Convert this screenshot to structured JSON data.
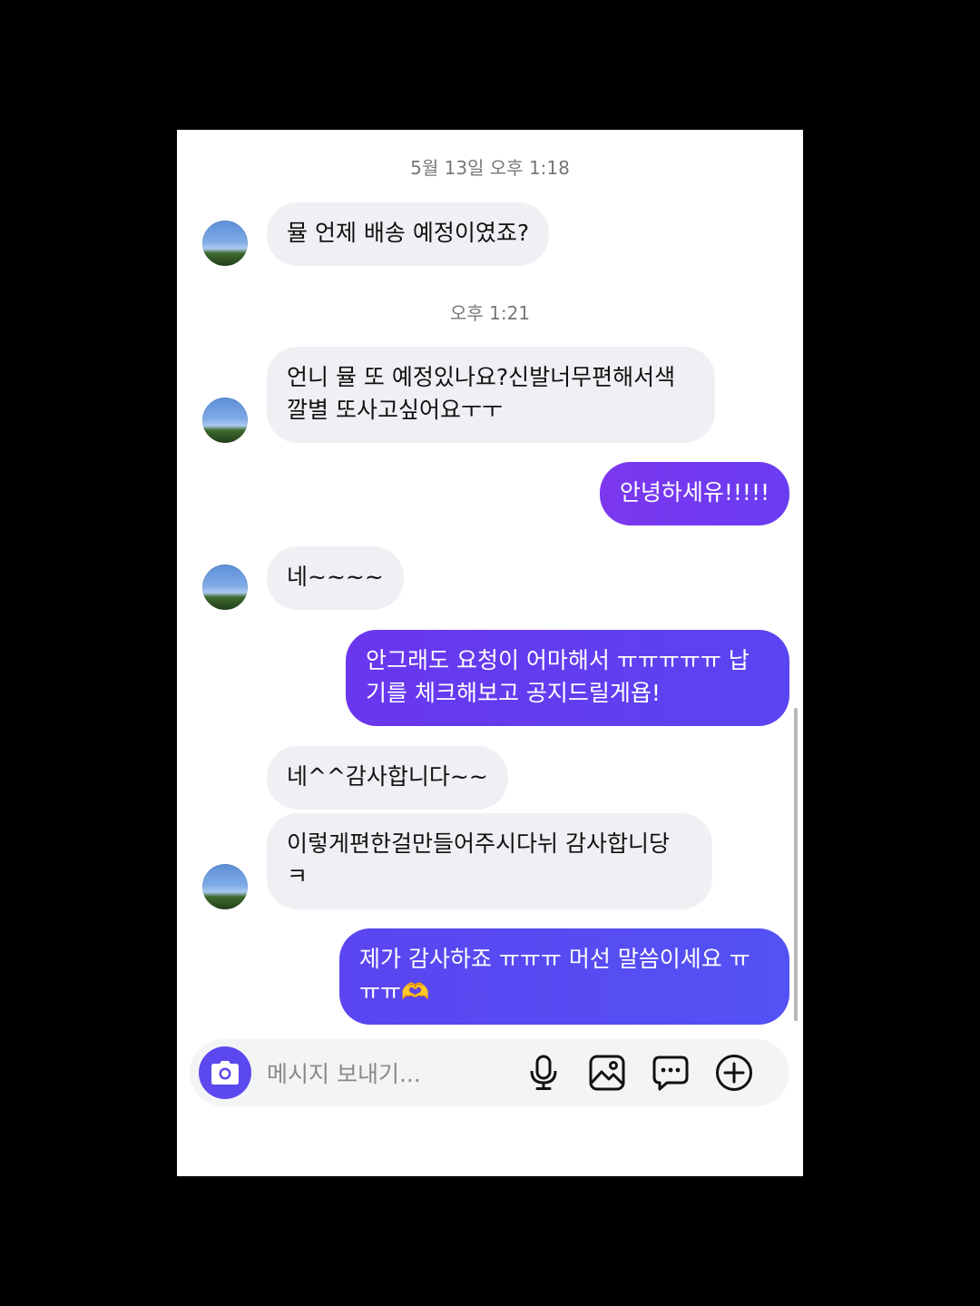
{
  "chat": {
    "timestamps": [
      "5월 13일 오후 1:18",
      "오후 1:21"
    ],
    "messages": [
      {
        "from": "other",
        "text": "뮬 언제 배송 예정이였죠?"
      },
      {
        "from": "other",
        "text": "언니 뮬 또 예정있나요?신발너무편해서색\n깔별 또사고싶어요ㅜㅜ"
      },
      {
        "from": "me",
        "text": "안녕하세유!!!!!"
      },
      {
        "from": "other",
        "text": "네~~~~"
      },
      {
        "from": "me",
        "text": "안그래도 요청이 어마해서 ㅠㅠㅠㅠㅠ 납\n기를 체크해보고 공지드릴게욥!"
      },
      {
        "from": "other",
        "text": "네^^감사합니다~~"
      },
      {
        "from": "other",
        "text": "이렇게편한걸만들어주시다뉘 감사합니당\nㅋ"
      },
      {
        "from": "me",
        "text": "제가 감사하죠 ㅠㅠㅠ 머선 말씀이세요 ㅠ\nㅠㅠ🫶"
      }
    ]
  },
  "composer": {
    "placeholder": "메시지 보내기...",
    "icons": [
      "camera-icon",
      "microphone-icon",
      "image-icon",
      "chat-icon",
      "add-icon"
    ]
  },
  "colors": {
    "outgoing_bubble": "#6a3cf1",
    "incoming_bubble": "#eff0f3",
    "camera_button": "#5b48ee"
  }
}
